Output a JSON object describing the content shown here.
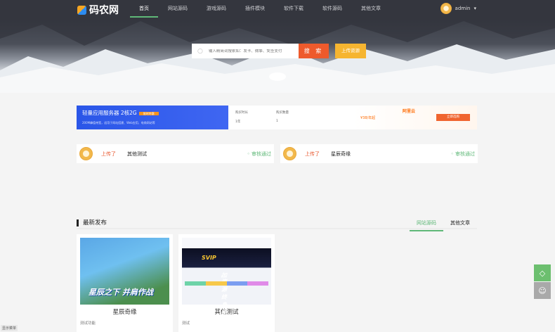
{
  "header": {
    "logo": "码农网",
    "nav": [
      "首页",
      "网站源码",
      "游戏源码",
      "插件模块",
      "软件下载",
      "软件源码",
      "其他文章"
    ],
    "user": "admin"
  },
  "search": {
    "placeholder": "输入精简词搜索如：发卡、微擎、免签支付",
    "button": "搜 索",
    "upload": "上传资源"
  },
  "ad": {
    "title": "轻量应用服务器 2核2G",
    "badge": "限时特惠",
    "sub": "200M峰值带宽，适用于网站搭建、Web应用、电商网站等",
    "duration_label": "购买时长",
    "duration": "1年",
    "qty_label": "购买数量",
    "qty": "1",
    "price": "¥38/年起",
    "brand": "阿里云",
    "buy": "立即选购"
  },
  "feed": [
    {
      "action": "上传了",
      "title": "其他测试",
      "status": "审核通过"
    },
    {
      "action": "上传了",
      "title": "星辰奇缘",
      "status": "审核通过"
    }
  ],
  "latest": {
    "title": "最新发布",
    "tabs": [
      "网站源码",
      "其他文章"
    ],
    "cards": [
      {
        "title": "星辰奇缘",
        "desc": "测试功能",
        "thumb_text": "星辰之下 并肩作战"
      },
      {
        "title": "其他测试",
        "desc": "测试",
        "thumb_text_a": "加入",
        "thumb_text_b": "SVIP",
        "thumb_text_c": ",资源终身免费"
      }
    ]
  },
  "show_menu": "显示菜单"
}
